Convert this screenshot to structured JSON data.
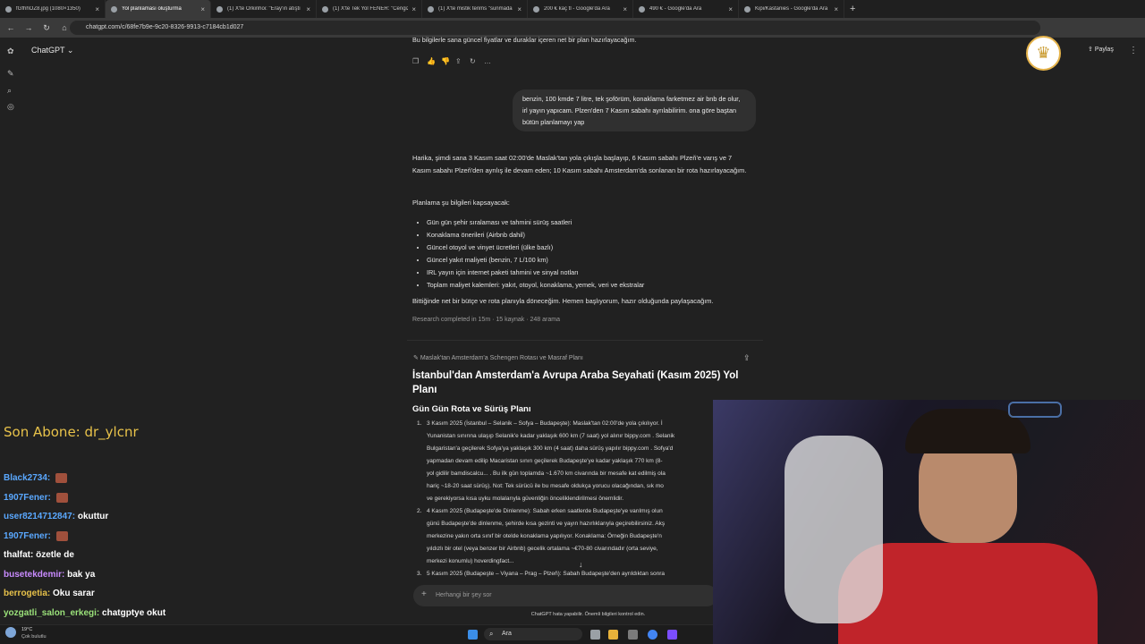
{
  "browser": {
    "tabs": [
      {
        "title": "fGfhhOZ8.jpg (1080×1350)",
        "active": false
      },
      {
        "title": "Yol planlaması oluşturma",
        "active": true
      },
      {
        "title": "(1) X'te Orkinhoi: \"Eray'ın atıştı",
        "active": false
      },
      {
        "title": "(1) X'te Tek Yol FENER: \"Cengiz",
        "active": false
      },
      {
        "title": "(1) X'te mistik terims \"sunmada",
        "active": false
      },
      {
        "title": "200 € kaç tl - Google'da Ara",
        "active": false
      },
      {
        "title": "490 € - Google'da Ara",
        "active": false
      },
      {
        "title": "Kipi/Kastanies - Google'da Ara",
        "active": false
      }
    ],
    "url": "chatgpt.com/c/68fe7b9e-9c20-8326-9913-c7184cb1d027"
  },
  "chatgpt": {
    "model_label": "ChatGPT",
    "share_label": "Paylaş",
    "top_text": "Bu bilgilerle sana güncel fiyatlar ve duraklar içeren net bir plan hazırlayacağım.",
    "user_message": "benzin, 100 kmde 7 litre, tek şoförüm, konaklama farketmez air bnb de olur, irl yayın yapıcam. Plzen'den 7 Kasım sabahı ayrılabilirim. ona göre baştan bütün planlamayı yap",
    "reply_intro": "Harika, şimdi sana 3 Kasım saat 02:00'de Maslak'tan yola çıkışla başlayıp, 6 Kasım sabahı Plzeň'e varış ve 7 Kasım sabahı Plzeň'den ayrılış ile devam eden; 10 Kasım sabahı Amsterdam'da sonlanan bir rota hazırlayacağım.",
    "plan_heading": "Planlama şu bilgileri kapsayacak:",
    "plan_items": [
      "Gün gün şehir sıralaması ve tahmini sürüş saatleri",
      "Konaklama önerileri (Airbnb dahil)",
      "Güncel otoyol ve vinyet ücretleri (ülke bazlı)",
      "Güncel yakıt maliyeti (benzin, 7 L/100 km)",
      "IRL yayın için internet paketi tahmini ve sinyal notları",
      "Toplam maliyet kalemleri: yakıt, otoyol, konaklama, yemek, veri ve ekstralar"
    ],
    "closing": "Bittiğinde net bir bütçe ve rota planıyla döneceğim. Hemen başlıyorum, hazır olduğunda paylaşacağım.",
    "research_status": "Research completed in 15m · 15 kaynak · 248 arama",
    "report_tag": "Maslak'tan Amsterdam'a Schengen Rotası ve Masraf Planı",
    "report_title": "İstanbul'dan Amsterdam'a Avrupa Araba Seyahati (Kasım 2025) Yol Planı",
    "section_title": "Gün Gün Rota ve Sürüş Planı",
    "items": [
      {
        "num": "1.",
        "lines": [
          "3 Kasım 2025 (İstanbul – Selanik – Sofya – Budapeşte): Maslak'tan 02:00'de yola çıkılıyor. İ",
          "Yunanistan sınırına ulaşıp Selanik'e kadar yaklaşık 600 km (7 saat) yol alınır  bippy.com . Selanik",
          "Bulgaristan'a geçilerek Sofya'ya yaklaşık 300 km (4 saat) daha sürüş yapılır  bippy.com . Sofya'd",
          "yapmadan devam edilip Macaristan sınırı geçilerek Budapeşte'ye kadar yaklaşık 770 km (8-",
          "yol gidilir  bamdiscalcu... . Bu ilk gün toplamda ~1.670 km civarında bir mesafe kat edilmiş ola",
          "hariç ~18-20 saat sürüş). Not: Tek sürücü ile bu mesafe oldukça yorucu olacağından, sık mo",
          "ve gerekiyorsa kısa uyku molalarıyla güvenliğin önceliklendirilmesi önemlidir."
        ]
      },
      {
        "num": "2.",
        "lines": [
          "4 Kasım 2025 (Budapeşte'de Dinlenme): Sabah erken saatlerde Budapeşte'ye varılmış olun",
          "günü Budapeşte'de dinlenme, şehirde kısa gezinti ve yayın hazırlıklarıyla geçirebilirsiniz. Akş",
          "merkezine yakın orta sınıf bir otelde konaklama yapılıyor. Konaklama: Örneğin Budapeşte'n",
          "yıldızlı bir otel (veya benzer bir Airbnb) gecelik ortalama ~€70-80 civarındadır (orta seviye,",
          "merkezi konumlu)  hoverdingfact..."
        ]
      },
      {
        "num": "3.",
        "lines": [
          "5 Kasım 2025 (Budapeşte – Viyana – Prag – Plzeň): Sabah Budapeşte'den ayrıldıktan sonra"
        ]
      }
    ],
    "composer_placeholder": "Herhangi bir şey sor",
    "disclaimer": "ChatGPT hata yapabilir. Önemli bilgileri kontrol edin."
  },
  "stream_overlay": {
    "last_sub": "Son Abone: dr_ylcnr",
    "chat": [
      {
        "user": "Black2734:",
        "color": "#5aa8ff",
        "msg": ""
      },
      {
        "user": "1907Fener:",
        "color": "#5aa8ff",
        "msg": ""
      },
      {
        "user": "user8214712847:",
        "color": "#5aa8ff",
        "msg": "okuttur"
      },
      {
        "user": "1907Fener:",
        "color": "#5aa8ff",
        "msg": ""
      },
      {
        "user": "thalfat:",
        "color": "#ffffff",
        "msg": "özetle de"
      },
      {
        "user": "busetekdemir:",
        "color": "#c98bff",
        "msg": "bak ya"
      },
      {
        "user": "berrogetia:",
        "color": "#e8c24a",
        "msg": "Oku sarar"
      },
      {
        "user": "yozgatli_salon_erkegi:",
        "color": "#9be27a",
        "msg": "chatgptye okut"
      }
    ]
  },
  "taskbar": {
    "weather_temp": "19°C",
    "weather_desc": "Çok bulutlu",
    "search_label": "Ara"
  }
}
